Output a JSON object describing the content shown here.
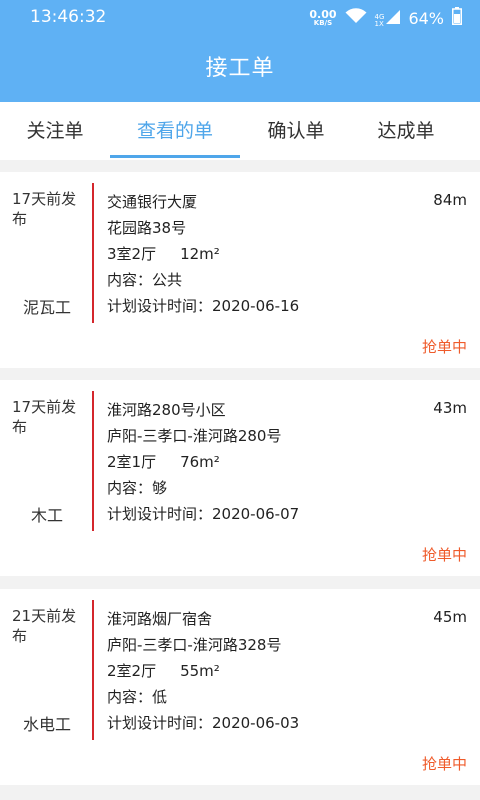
{
  "statusbar": {
    "time": "13:46:32",
    "net_speed": "0.00",
    "net_unit": "KB/S",
    "network_type": "4G",
    "sim_slot": "1X",
    "battery": "64%"
  },
  "header": {
    "title": "接工单"
  },
  "tabs": [
    {
      "label": "关注单",
      "active": false
    },
    {
      "label": "查看的单",
      "active": true
    },
    {
      "label": "确认单",
      "active": false
    },
    {
      "label": "达成单",
      "active": false
    }
  ],
  "orders": [
    {
      "posted": "17天前发布",
      "trade": "泥瓦工",
      "name": "交通银行大厦",
      "address": "花园路38号",
      "rooms": "3室2厅",
      "area": "12m²",
      "content": "内容：公共",
      "plan_time": "计划设计时间：2020-06-16",
      "distance": "84m",
      "status": "抢单中"
    },
    {
      "posted": "17天前发布",
      "trade": "木工",
      "name": "淮河路280号小区",
      "address": "庐阳-三孝口-淮河路280号",
      "rooms": "2室1厅",
      "area": "76m²",
      "content": "内容：够",
      "plan_time": "计划设计时间：2020-06-07",
      "distance": "43m",
      "status": "抢单中"
    },
    {
      "posted": "21天前发布",
      "trade": "水电工",
      "name": "淮河路烟厂宿舍",
      "address": "庐阳-三孝口-淮河路328号",
      "rooms": "2室2厅",
      "area": "55m²",
      "content": "内容：低",
      "plan_time": "计划设计时间：2020-06-03",
      "distance": "45m",
      "status": "抢单中"
    }
  ],
  "colors": {
    "primary": "#5fb1f4",
    "tab_active": "#4fa6ea",
    "status": "#ef5b2b",
    "divider": "#d4262c"
  }
}
